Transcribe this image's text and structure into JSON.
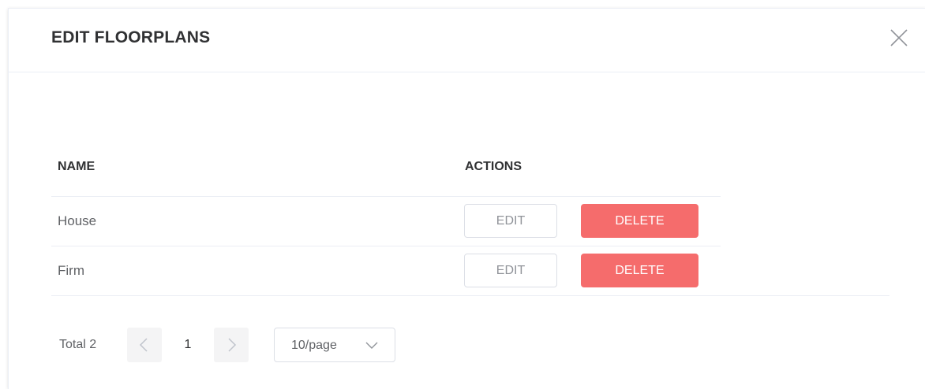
{
  "dialog": {
    "title": "EDIT FLOORPLANS"
  },
  "table": {
    "columns": [
      "NAME",
      "ACTIONS"
    ],
    "rows": [
      {
        "name": "House",
        "edit_label": "EDIT",
        "delete_label": "DELETE"
      },
      {
        "name": "Firm",
        "edit_label": "EDIT",
        "delete_label": "DELETE"
      }
    ]
  },
  "pagination": {
    "total_label": "Total 2",
    "current_page": "1",
    "page_size": "10/page"
  },
  "icons": {
    "close": "close-icon",
    "prev": "chevron-left-icon",
    "next": "chevron-right-icon",
    "select": "chevron-down-icon"
  },
  "colors": {
    "danger": "#f56c6c",
    "title": "#303133",
    "border": "#ebeef5"
  }
}
